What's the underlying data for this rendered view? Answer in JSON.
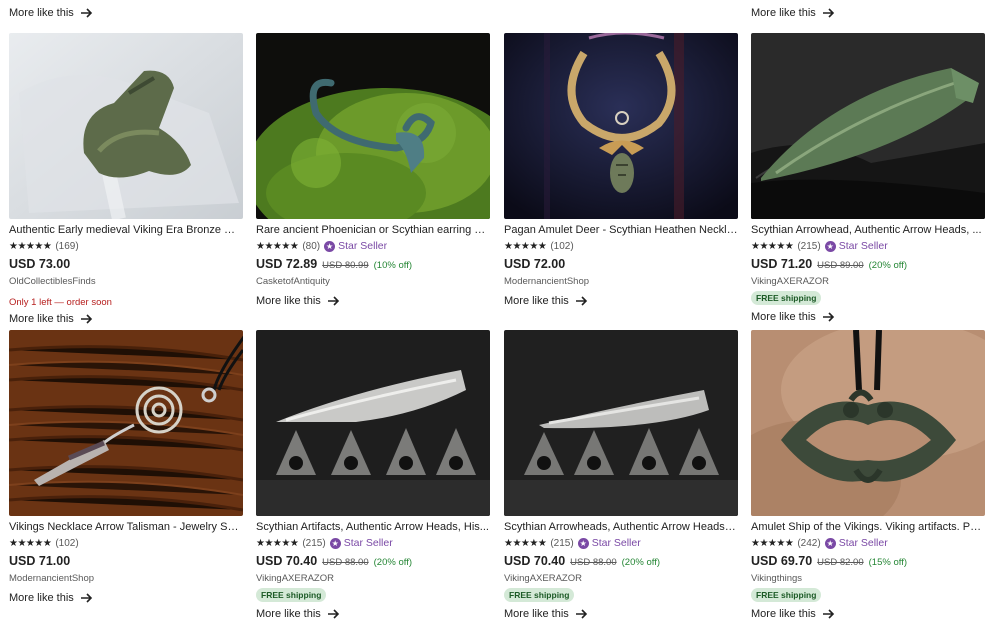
{
  "top_links": [
    "More like this",
    "More like this"
  ],
  "more_label": "More like this",
  "star_seller_label": "Star Seller",
  "free_shipping_label": "FREE shipping",
  "listings": [
    {
      "title": "Authentic Early medieval Viking Era Bronze We...",
      "stars": "★★★★★",
      "reviews": "(169)",
      "star_seller": false,
      "price": "USD 73.00",
      "original_price": "",
      "discount": "",
      "shop": "OldCollectiblesFinds",
      "stock_note": "Only 1 left — order soon",
      "free_shipping": false,
      "image": "bronze-artifact-on-glass"
    },
    {
      "title": "Rare ancient Phoenician or Scythian earring ca...",
      "stars": "★★★★★",
      "reviews": "(80)",
      "star_seller": true,
      "price": "USD 72.89",
      "original_price": "USD 80.99",
      "discount": "(10% off)",
      "shop": "CasketofAntiquity",
      "stock_note": "",
      "free_shipping": false,
      "image": "earring-on-moss"
    },
    {
      "title": "Pagan Amulet Deer - Scythian Heathen Neckla...",
      "stars": "★★★★★",
      "reviews": "(102)",
      "star_seller": false,
      "price": "USD 72.00",
      "original_price": "",
      "discount": "",
      "shop": "ModernancientShop",
      "stock_note": "",
      "free_shipping": false,
      "image": "torc-necklace-amulet"
    },
    {
      "title": "Scythian Arrowhead, Authentic Arrow Heads, ...",
      "stars": "★★★★★",
      "reviews": "(215)",
      "star_seller": true,
      "price": "USD 71.20",
      "original_price": "USD 89.00",
      "discount": "(20% off)",
      "shop": "VikingAXERAZOR",
      "stock_note": "",
      "free_shipping": true,
      "image": "green-arrowhead-on-rock"
    },
    {
      "title": "Vikings Necklace Arrow Talisman - Jewelry Scy...",
      "stars": "★★★★★",
      "reviews": "(102)",
      "star_seller": false,
      "price": "USD 71.00",
      "original_price": "",
      "discount": "",
      "shop": "ModernancientShop",
      "stock_note": "",
      "free_shipping": false,
      "image": "spiral-arrow-pendant-on-wood"
    },
    {
      "title": "Scythian Artifacts, Authentic Arrow Heads, His...",
      "stars": "★★★★★",
      "reviews": "(215)",
      "star_seller": true,
      "price": "USD 70.40",
      "original_price": "USD 88.00",
      "discount": "(20% off)",
      "shop": "VikingAXERAZOR",
      "stock_note": "",
      "free_shipping": true,
      "image": "silver-arrowheads-set"
    },
    {
      "title": "Scythian Arrowheads, Authentic Arrow Heads, ...",
      "stars": "★★★★★",
      "reviews": "(215)",
      "star_seller": true,
      "price": "USD 70.40",
      "original_price": "USD 88.00",
      "discount": "(20% off)",
      "shop": "VikingAXERAZOR",
      "stock_note": "",
      "free_shipping": true,
      "image": "silver-arrowheads-set"
    },
    {
      "title": "Amulet Ship of the Vikings. Viking artifacts. Pe...",
      "stars": "★★★★★",
      "reviews": "(242)",
      "star_seller": true,
      "price": "USD 69.70",
      "original_price": "USD 82.00",
      "discount": "(15% off)",
      "shop": "Vikingthings",
      "stock_note": "",
      "free_shipping": true,
      "image": "bronze-ship-amulet"
    }
  ]
}
